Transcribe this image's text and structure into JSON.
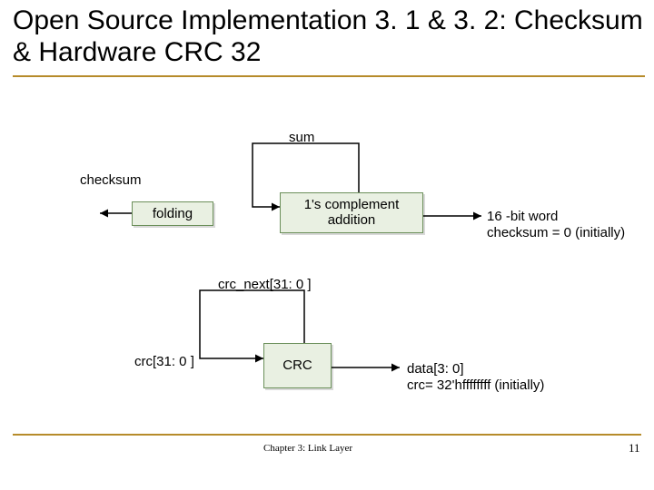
{
  "title": "Open Source Implementation 3. 1 & 3. 2: Checksum & Hardware CRC 32",
  "labels": {
    "sum": "sum",
    "checksum": "checksum",
    "folding": "folding",
    "ones_comp": "1's complement addition",
    "word16": "16 -bit word",
    "checksum_init": "checksum = 0 (initially)",
    "crc_next": "crc_next[31: 0 ]",
    "crc_reg": "crc[31: 0 ]",
    "crc_box": "CRC",
    "data": "data[3: 0]",
    "crc_init": "crc= 32'hffffffff (initially)"
  },
  "footer": "Chapter 3: Link Layer",
  "page": "11"
}
